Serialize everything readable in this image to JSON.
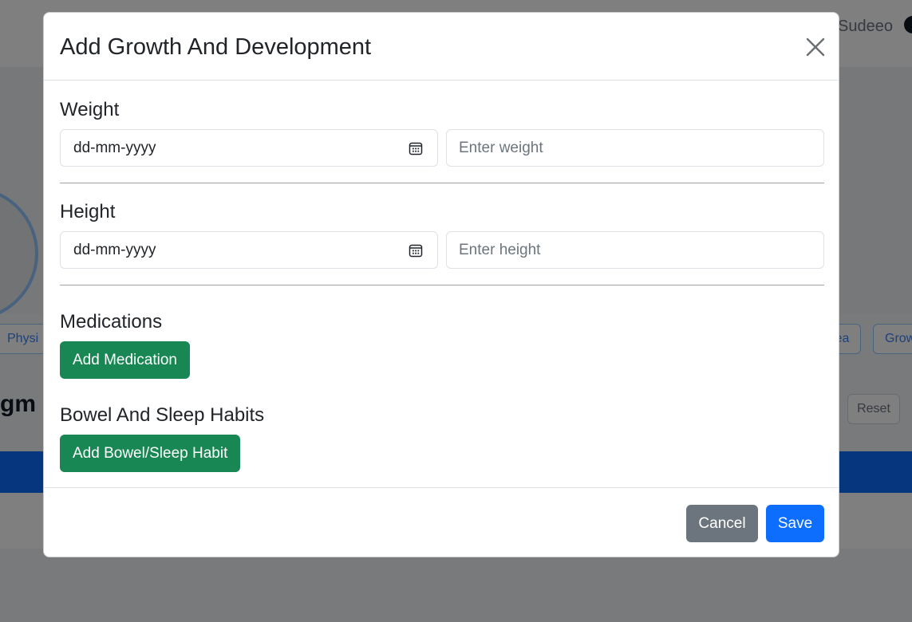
{
  "background": {
    "topbar_text": "Sudeeo",
    "tabs": [
      "Physi",
      "Hea",
      "Grow"
    ],
    "heading": "gm",
    "reset_label": "Reset"
  },
  "modal": {
    "title": "Add Growth And Development",
    "weight": {
      "title": "Weight",
      "date_value": "dd-mm-yyyy",
      "placeholder": "Enter weight"
    },
    "height": {
      "title": "Height",
      "date_value": "dd-mm-yyyy",
      "placeholder": "Enter height"
    },
    "medications": {
      "title": "Medications",
      "button_label": "Add Medication"
    },
    "bowel_sleep": {
      "title": "Bowel And Sleep Habits",
      "button_label": "Add Bowel/Sleep Habit"
    },
    "footer": {
      "cancel_label": "Cancel",
      "save_label": "Save"
    }
  },
  "icons": {
    "close": "close-icon",
    "calendar": "calendar-icon"
  },
  "colors": {
    "success": "#198754",
    "secondary": "#6c757d",
    "primary": "#0d6efd",
    "backdrop": "rgba(0,0,0,0.5)"
  }
}
